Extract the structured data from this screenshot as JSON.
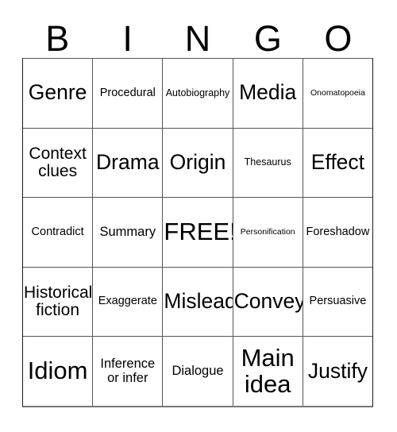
{
  "card": {
    "title": "BINGO card",
    "header_letters": [
      "B",
      "I",
      "N",
      "G",
      "O"
    ],
    "free_space": "FREE!",
    "colors": {
      "background": "#ffffff",
      "text": "#000000",
      "grid_line": "#555555",
      "grid_outer": "#1a1a1a"
    },
    "rows": [
      [
        {
          "label": "Genre",
          "size": "xxl"
        },
        {
          "label": "Procedural",
          "size": "md"
        },
        {
          "label": "Autobiography",
          "size": "sm"
        },
        {
          "label": "Media",
          "size": "xxl"
        },
        {
          "label": "Onomatopoeia",
          "size": "xs"
        }
      ],
      [
        {
          "label": "Context\nclues",
          "size": "xl"
        },
        {
          "label": "Drama",
          "size": "xxl"
        },
        {
          "label": "Origin",
          "size": "xxl"
        },
        {
          "label": "Thesaurus",
          "size": "sm"
        },
        {
          "label": "Effect",
          "size": "xxl"
        }
      ],
      [
        {
          "label": "Contradict",
          "size": "md"
        },
        {
          "label": "Summary",
          "size": "lg"
        },
        {
          "label": "FREE!",
          "size": "xxxl"
        },
        {
          "label": "Personification",
          "size": "xs"
        },
        {
          "label": "Foreshadow",
          "size": "md"
        }
      ],
      [
        {
          "label": "Historical\nfiction",
          "size": "xl"
        },
        {
          "label": "Exaggerate",
          "size": "md"
        },
        {
          "label": "Mislead",
          "size": "xxl"
        },
        {
          "label": "Convey",
          "size": "xxl"
        },
        {
          "label": "Persuasive",
          "size": "md"
        }
      ],
      [
        {
          "label": "Idiom",
          "size": "xxxl"
        },
        {
          "label": "Inference\nor infer",
          "size": "lg"
        },
        {
          "label": "Dialogue",
          "size": "lg"
        },
        {
          "label": "Main\nidea",
          "size": "xxxl"
        },
        {
          "label": "Justify",
          "size": "xxl"
        }
      ]
    ]
  }
}
